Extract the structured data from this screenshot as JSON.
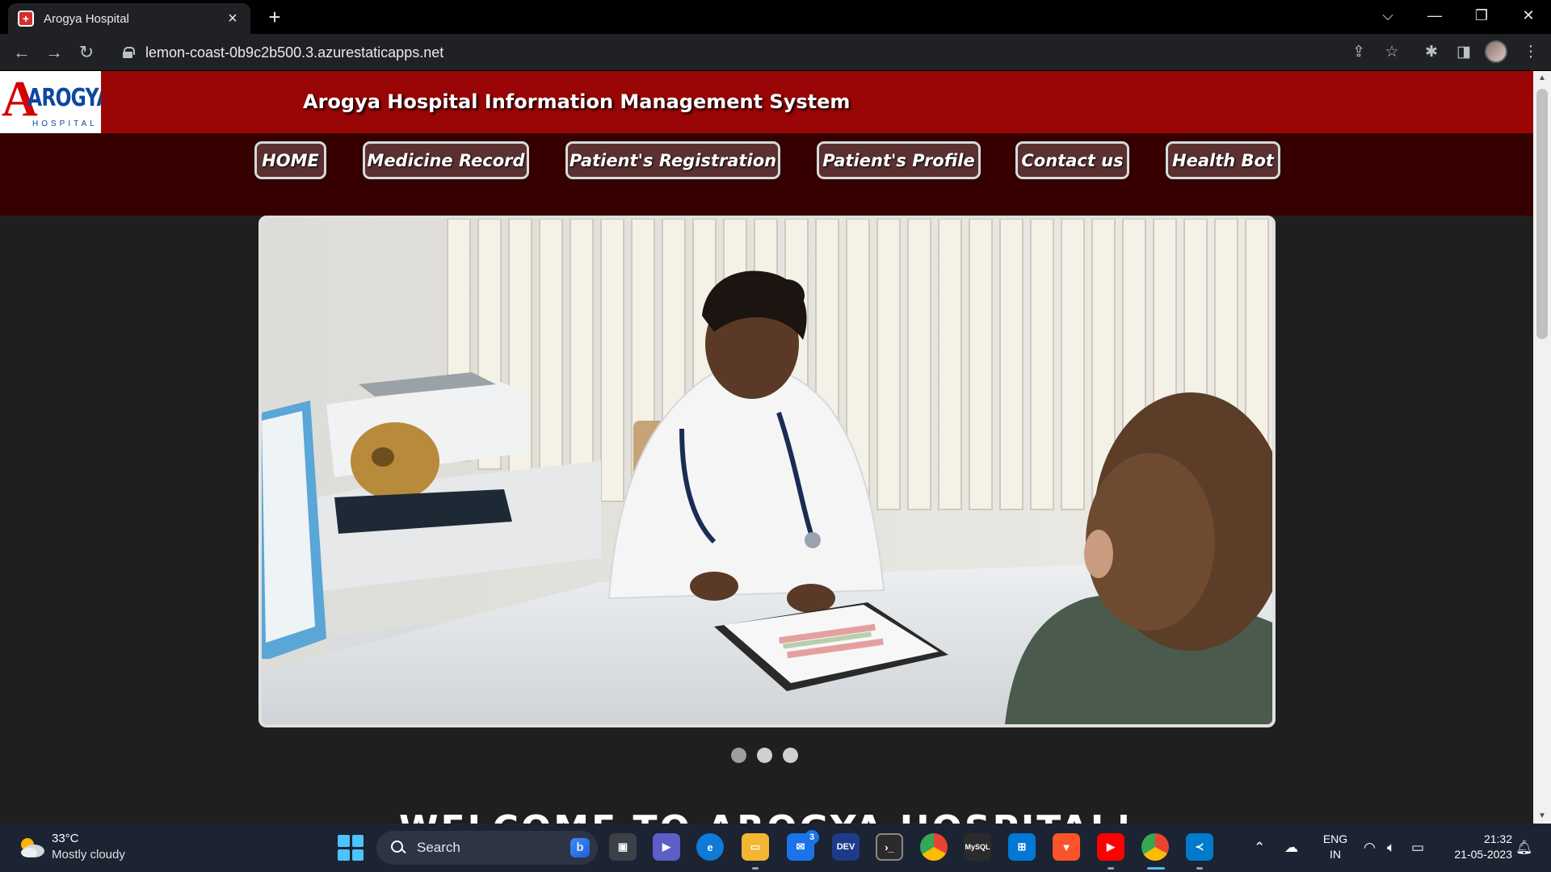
{
  "browser": {
    "tab_title": "Arogya Hospital",
    "tab_favicon": "+",
    "url": "lemon-coast-0b9c2b500.3.azurestaticapps.net"
  },
  "header": {
    "logo_text": "AROGYA",
    "logo_letter": "A",
    "logo_subtext": "HOSPITAL",
    "title": "Arogya Hospital Information Management System"
  },
  "nav": {
    "items": [
      {
        "label": "HOME"
      },
      {
        "label": "Medicine Record"
      },
      {
        "label": "Patient's Registration"
      },
      {
        "label": "Patient's Profile"
      },
      {
        "label": "Contact us"
      },
      {
        "label": "Health Bot"
      }
    ]
  },
  "carousel": {
    "slide_count": 3,
    "active_index": 0
  },
  "welcome": {
    "text": "WELCOME TO AROGYA HOSPITAL!"
  },
  "taskbar": {
    "weather_temp": "33°C",
    "weather_desc": "Mostly cloudy",
    "search_placeholder": "Search",
    "mail_badge": "3",
    "lang_line1": "ENG",
    "lang_line2": "IN",
    "time": "21:32",
    "date": "21-05-2023"
  }
}
